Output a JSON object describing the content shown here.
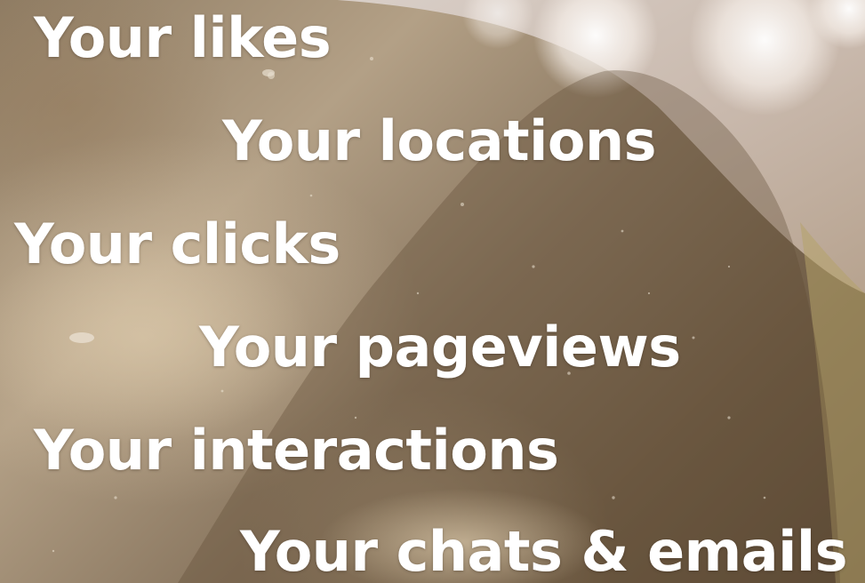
{
  "lines": [
    "Your likes",
    "Your locations",
    "Your clicks",
    "Your pageviews",
    "Your interactions",
    "Your chats & emails"
  ],
  "colors": {
    "text": "#ffffff",
    "background_warm": "#8f7c63",
    "background_dark": "#5c4a36",
    "bokeh_light": "#f4eee8"
  }
}
